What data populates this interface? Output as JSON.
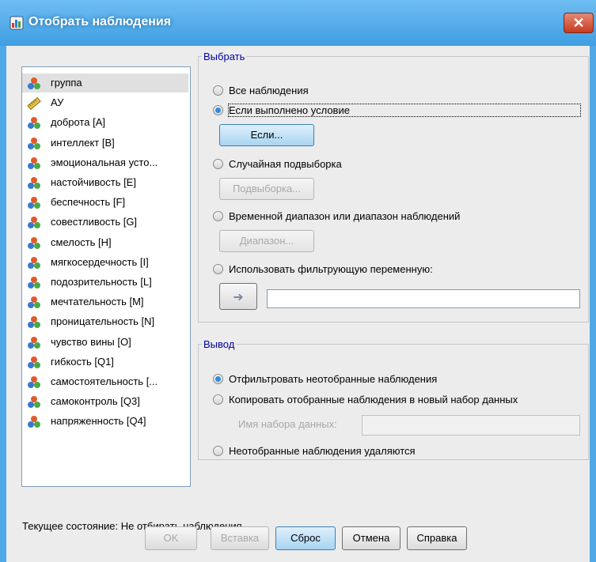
{
  "window": {
    "title": "Отобрать наблюдения",
    "close_glyph": "✕"
  },
  "variables": [
    {
      "label": "группа",
      "icon": "nominal-icon",
      "selected": true
    },
    {
      "label": "АУ",
      "icon": "scale-ruler-icon"
    },
    {
      "label": "доброта [A]",
      "icon": "nominal-icon"
    },
    {
      "label": "интеллект [B]",
      "icon": "nominal-icon"
    },
    {
      "label": "эмоциональная усто...",
      "icon": "nominal-icon"
    },
    {
      "label": "настойчивость [E]",
      "icon": "nominal-icon"
    },
    {
      "label": "беспечность [F]",
      "icon": "nominal-icon"
    },
    {
      "label": "совестливость [G]",
      "icon": "nominal-icon"
    },
    {
      "label": "смелость [H]",
      "icon": "nominal-icon"
    },
    {
      "label": "мягкосердечность [I]",
      "icon": "nominal-icon"
    },
    {
      "label": "подозрительность [L]",
      "icon": "nominal-icon"
    },
    {
      "label": "мечтательность [M]",
      "icon": "nominal-icon"
    },
    {
      "label": "проницательность [N]",
      "icon": "nominal-icon"
    },
    {
      "label": "чувство вины [O]",
      "icon": "nominal-icon"
    },
    {
      "label": "гибкость [Q1]",
      "icon": "nominal-icon"
    },
    {
      "label": "самостоятельность [...",
      "icon": "nominal-icon"
    },
    {
      "label": "самоконтроль [Q3]",
      "icon": "nominal-icon"
    },
    {
      "label": "напряженность [Q4]",
      "icon": "nominal-icon"
    }
  ],
  "select_group": {
    "legend": "Выбрать",
    "all_cases": "Все наблюдения",
    "if_condition": "Если выполнено условие",
    "if_button": "Если...",
    "random_sample": "Случайная подвыборка",
    "sample_button": "Подвыборка...",
    "range": "Временной  диапазон или диапазон наблюдений",
    "range_button": "Диапазон...",
    "filter_variable": "Использовать фильтрующую переменную:",
    "move_arrow": "➜",
    "selected_option": "if_condition"
  },
  "output_group": {
    "legend": "Вывод",
    "filter_out": "Отфильтровать неотобранные наблюдения",
    "copy": "Копировать отобранные наблюдения в новый набор данных",
    "dataset_name_label": "Имя набора данных:",
    "delete": "Неотобранные наблюдения удаляются",
    "selected_option": "filter_out"
  },
  "status": "Текущее состояние: Не отбирать наблюдения",
  "buttons": {
    "ok": "OK",
    "paste": "Вставка",
    "reset": "Сброс",
    "cancel": "Отмена",
    "help": "Справка"
  },
  "colors": {
    "title_bar": "#4fa9e6",
    "close_button": "#c73b20",
    "radio_dot": "#2e8be0",
    "legend_text": "#0000a0"
  }
}
